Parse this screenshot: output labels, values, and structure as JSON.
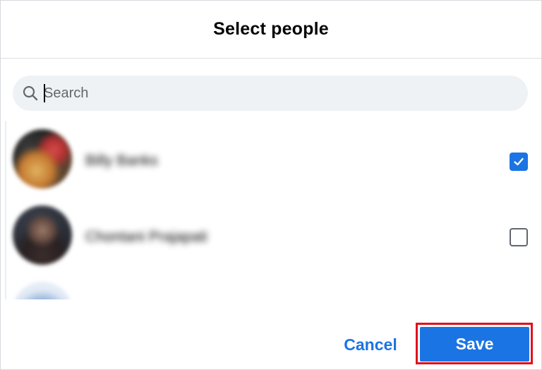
{
  "dialog": {
    "title": "Select people"
  },
  "search": {
    "placeholder": "Search",
    "value": ""
  },
  "people": [
    {
      "name": "Billy Banks",
      "checked": true
    },
    {
      "name": "Chontani Prajapati",
      "checked": false
    }
  ],
  "icons": {
    "search": "search-icon",
    "check": "check-icon"
  },
  "footer": {
    "cancel_label": "Cancel",
    "save_label": "Save"
  },
  "colors": {
    "accent": "#1b74e4",
    "highlight": "#e0101d",
    "search_bg": "#eff2f5"
  }
}
